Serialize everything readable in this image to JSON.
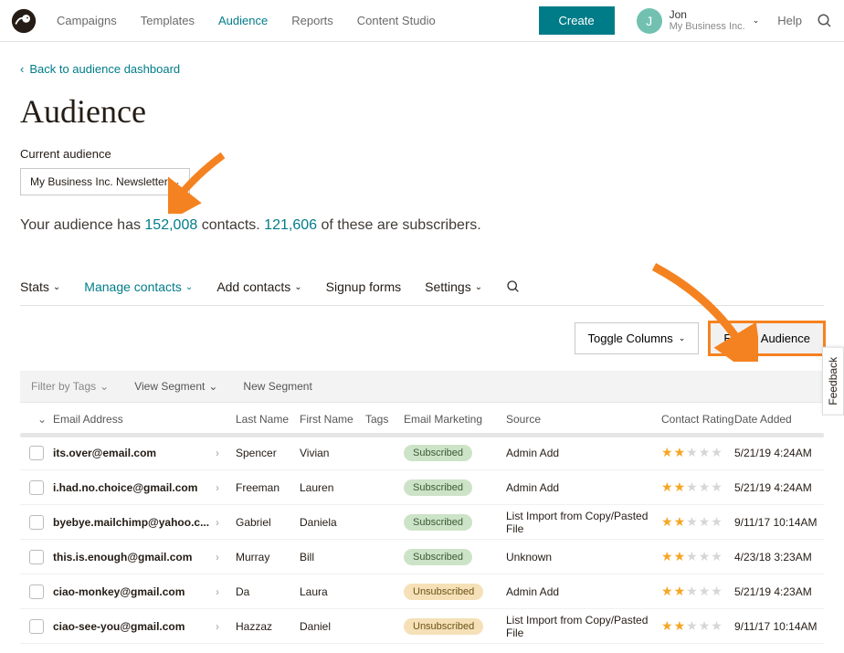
{
  "nav": {
    "items": [
      "Campaigns",
      "Templates",
      "Audience",
      "Reports",
      "Content Studio"
    ],
    "active": "Audience",
    "create": "Create",
    "user_initial": "J",
    "user_name": "Jon",
    "user_org": "My Business Inc.",
    "help": "Help"
  },
  "back_link": "Back to audience dashboard",
  "page_title": "Audience",
  "current_label": "Current audience",
  "audience_selected": "My Business Inc. Newsletter",
  "summary": {
    "prefix": "Your audience has ",
    "contacts": "152,008",
    "mid": " contacts. ",
    "subs": "121,606",
    "suffix": " of these are subscribers."
  },
  "subtabs": {
    "stats": "Stats",
    "manage": "Manage contacts",
    "add": "Add contacts",
    "signup": "Signup forms",
    "settings": "Settings"
  },
  "actions": {
    "toggle": "Toggle Columns",
    "export": "Export Audience"
  },
  "filters": {
    "tags": "Filter by Tags",
    "view": "View Segment",
    "newseg": "New Segment"
  },
  "columns": {
    "email": "Email Address",
    "last": "Last Name",
    "first": "First Name",
    "tags": "Tags",
    "marketing": "Email Marketing",
    "source": "Source",
    "rating": "Contact Rating",
    "date": "Date Added"
  },
  "rows": [
    {
      "email": "its.over@email.com",
      "last": "Spencer",
      "first": "Vivian",
      "status": "Subscribed",
      "source": "Admin Add",
      "rating": 2,
      "date": "5/21/19 4:24AM"
    },
    {
      "email": "i.had.no.choice@gmail.com",
      "last": "Freeman",
      "first": "Lauren",
      "status": "Subscribed",
      "source": "Admin Add",
      "rating": 2,
      "date": "5/21/19 4:24AM"
    },
    {
      "email": "byebye.mailchimp@yahoo.c...",
      "last": "Gabriel",
      "first": "Daniela",
      "status": "Subscribed",
      "source": "List Import from Copy/Pasted File",
      "rating": 2,
      "date": "9/11/17 10:14AM"
    },
    {
      "email": "this.is.enough@gmail.com",
      "last": "Murray",
      "first": "Bill",
      "status": "Subscribed",
      "source": "Unknown",
      "rating": 2,
      "date": "4/23/18 3:23AM"
    },
    {
      "email": "ciao-monkey@gmail.com",
      "last": "Da",
      "first": "Laura",
      "status": "Unsubscribed",
      "source": "Admin Add",
      "rating": 2,
      "date": "5/21/19 4:23AM"
    },
    {
      "email": "ciao-see-you@gmail.com",
      "last": "Hazzaz",
      "first": "Daniel",
      "status": "Unsubscribed",
      "source": "List Import from Copy/Pasted File",
      "rating": 2,
      "date": "9/11/17 10:14AM"
    }
  ],
  "feedback": "Feedback"
}
